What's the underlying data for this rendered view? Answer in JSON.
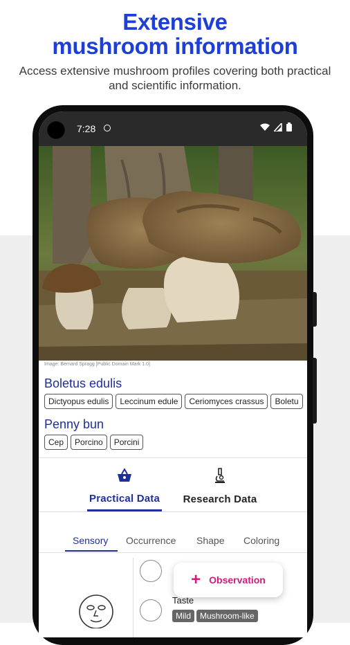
{
  "promo": {
    "headline_line1": "Extensive",
    "headline_line2": "mushroom information",
    "subtitle": "Access extensive mushroom profiles covering both practical and scientific information."
  },
  "status_bar": {
    "time": "7:28",
    "icons": [
      "circle-notification-icon",
      "wifi-icon",
      "signal-icon",
      "battery-icon"
    ]
  },
  "photo": {
    "credit": "Image: Bernard Spragg [Public Domain Mark 1.0]"
  },
  "species": {
    "scientific_name": "Boletus edulis",
    "synonyms": [
      "Dictyopus edulis",
      "Leccinum edule",
      "Ceriomyces crassus",
      "Boletu"
    ],
    "common_name": "Penny bun",
    "common_names": [
      "Cep",
      "Porcino",
      "Porcini"
    ]
  },
  "main_tabs": [
    {
      "label": "Practical Data",
      "icon": "basket-icon",
      "active": true
    },
    {
      "label": "Research Data",
      "icon": "microscope-icon",
      "active": false
    }
  ],
  "sub_tabs": [
    {
      "label": "Sensory",
      "active": true
    },
    {
      "label": "Occurrence",
      "active": false
    },
    {
      "label": "Shape",
      "active": false
    },
    {
      "label": "Coloring",
      "active": false
    }
  ],
  "sensory": {
    "taste_label": "Taste",
    "taste_tags": [
      "Mild",
      "Mushroom-like"
    ]
  },
  "fab": {
    "label": "Observation",
    "icon": "plus-icon"
  },
  "colors": {
    "brand_blue": "#1e3fd6",
    "accent_navy": "#1e2f9a",
    "fab_accent": "#d01b7a"
  }
}
